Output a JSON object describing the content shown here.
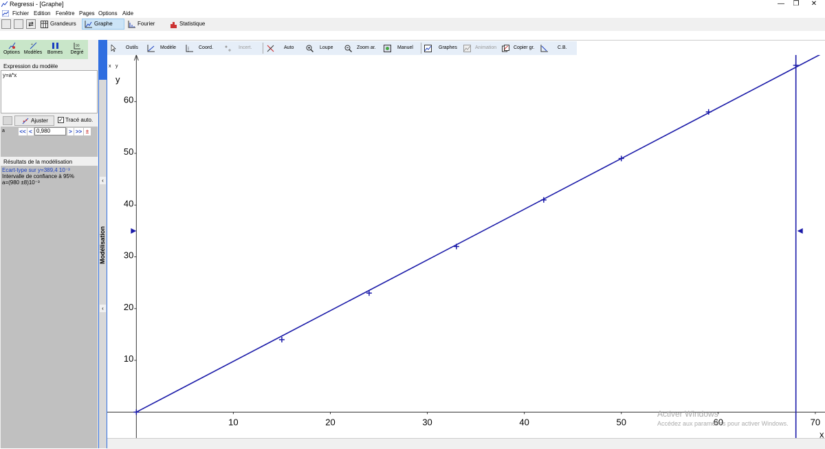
{
  "window": {
    "title": "Regressi - [Graphe]",
    "minimize": "—",
    "maximize": "❐",
    "close": "✕"
  },
  "menu": [
    "Fichier",
    "Edition",
    "Fenêtre",
    "Pages",
    "Options",
    "Aide"
  ],
  "toolbar": {
    "grandeurs": "Grandeurs",
    "graphe": "Graphe",
    "fourier": "Fourier",
    "statistique": "Statistique"
  },
  "left_toolbar": {
    "options": "Options",
    "modeles": "Modèles",
    "bornes": "Bornes",
    "degre": "Degré",
    "degre_icon": "90"
  },
  "model": {
    "header": "Expression du modèle",
    "expression": "y=a*x",
    "ajuster": "Ajuster",
    "trace_auto": "Tracé auto.",
    "param_name": "a",
    "param_value": "0,980",
    "btn_first": "<<",
    "btn_prev": "<",
    "btn_next": ">",
    "btn_last": ">>",
    "btn_pm": "±"
  },
  "results": {
    "header": "Résultats de la modélisation",
    "ecart_type": "Ecart-type sur y=389,4 10⁻³",
    "intervalle": "Intervalle de confiance à 95%",
    "a_value": "a=(980 ±8)10⁻³"
  },
  "splitter_label": "Modélisation",
  "graph_toolbar": {
    "outils": "Outils",
    "modele": "Modèle",
    "coord": "Coord.",
    "incert": "Incert.",
    "auto": "Auto",
    "loupe": "Loupe",
    "zoom": "Zoom ar.",
    "manuel": "Manuel",
    "graphes": "Graphes",
    "animation": "Animation",
    "copier": "Copier gr.",
    "cb": "C.B."
  },
  "graph_header": {
    "x": "x",
    "y": "y"
  },
  "watermark": {
    "line1": "Activer Windows",
    "line2": "Accédez aux paramètres pour activer Windows."
  },
  "chart_data": {
    "type": "scatter",
    "xlabel": "x",
    "ylabel": "y",
    "xlim": [
      -3,
      71
    ],
    "ylim": [
      -7,
      69
    ],
    "xticks": [
      10,
      20,
      30,
      40,
      50,
      60,
      70
    ],
    "yticks": [
      10,
      20,
      30,
      40,
      50,
      60
    ],
    "points": [
      [
        0,
        0
      ],
      [
        15,
        14
      ],
      [
        24,
        23
      ],
      [
        33,
        32
      ],
      [
        42,
        41
      ],
      [
        50,
        49
      ],
      [
        59,
        58
      ],
      [
        68,
        67
      ]
    ],
    "model": {
      "expression": "y=a*x",
      "a": 0.98
    },
    "cursor_x": 68,
    "color": "#1a1aa8"
  }
}
